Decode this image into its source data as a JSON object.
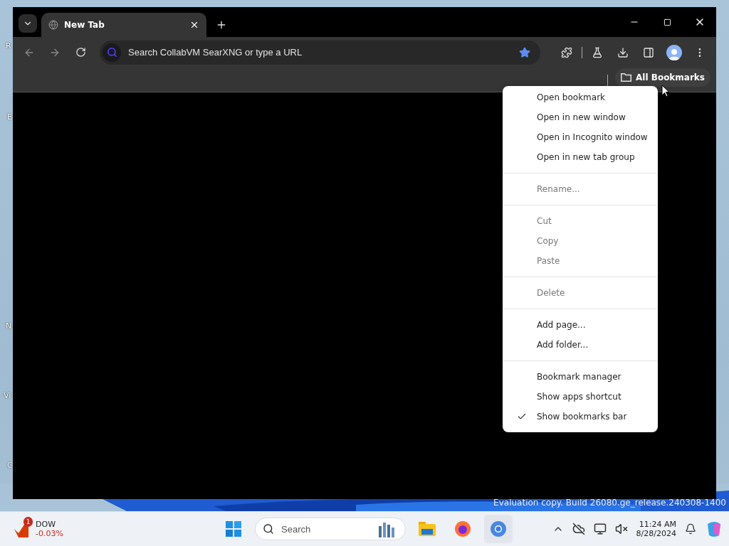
{
  "desktop": {
    "icon_labels": [
      "R",
      "E",
      "N",
      "Vi",
      "C"
    ],
    "watermark": "Evaluation copy. Build 26080.ge_release.240308-1400"
  },
  "browser": {
    "tabs": [
      {
        "title": "New Tab",
        "selected": true
      }
    ],
    "omnibox": {
      "placeholder": "Search CollabVM SearXNG or type a URL",
      "bookmarked": true
    },
    "bookmarks_bar": {
      "folder": "All Bookmarks"
    }
  },
  "context_menu": {
    "groups": [
      [
        {
          "label": "Open bookmark",
          "disabled": false,
          "checked": false
        },
        {
          "label": "Open in new window",
          "disabled": false,
          "checked": false
        },
        {
          "label": "Open in Incognito window",
          "disabled": false,
          "checked": false
        },
        {
          "label": "Open in new tab group",
          "disabled": false,
          "checked": false
        }
      ],
      [
        {
          "label": "Rename...",
          "disabled": true,
          "checked": false
        }
      ],
      [
        {
          "label": "Cut",
          "disabled": true,
          "checked": false
        },
        {
          "label": "Copy",
          "disabled": true,
          "checked": false
        },
        {
          "label": "Paste",
          "disabled": true,
          "checked": false
        }
      ],
      [
        {
          "label": "Delete",
          "disabled": true,
          "checked": false
        }
      ],
      [
        {
          "label": "Add page...",
          "disabled": false,
          "checked": false
        },
        {
          "label": "Add folder...",
          "disabled": false,
          "checked": false
        }
      ],
      [
        {
          "label": "Bookmark manager",
          "disabled": false,
          "checked": false
        },
        {
          "label": "Show apps shortcut",
          "disabled": false,
          "checked": false
        },
        {
          "label": "Show bookmarks bar",
          "disabled": false,
          "checked": true
        }
      ]
    ]
  },
  "taskbar": {
    "widget": {
      "title": "DOW",
      "change": "-0.03%",
      "badge": "1"
    },
    "search": {
      "placeholder": "Search"
    },
    "clock": {
      "time": "11:24 AM",
      "date": "8/28/2024"
    }
  }
}
